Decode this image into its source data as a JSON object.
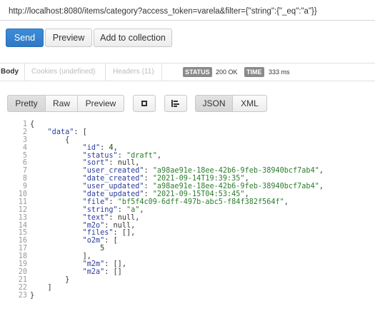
{
  "request": {
    "url": "http://localhost:8080/items/category?access_token=varela&filter={\"string\":{\"_eq\":\"a\"}}"
  },
  "actions": {
    "send_label": "Send",
    "preview_label": "Preview",
    "add_label": "Add to collection"
  },
  "tabs": {
    "body": "Body",
    "cookies": "Cookies (undefined)",
    "headers": "Headers (11)"
  },
  "status": {
    "status_label": "STATUS",
    "status_value": "200 OK",
    "time_label": "TIME",
    "time_value": "333 ms"
  },
  "format": {
    "pretty": "Pretty",
    "raw": "Raw",
    "preview": "Preview",
    "json": "JSON",
    "xml": "XML"
  },
  "response_lines": [
    [
      [
        "p",
        "{"
      ]
    ],
    [
      [
        "p",
        "    "
      ],
      [
        "k",
        "\"data\""
      ],
      [
        "p",
        ": ["
      ]
    ],
    [
      [
        "p",
        "        {"
      ]
    ],
    [
      [
        "p",
        "            "
      ],
      [
        "k",
        "\"id\""
      ],
      [
        "p",
        ": "
      ],
      [
        "n",
        "4"
      ],
      [
        "p",
        ","
      ]
    ],
    [
      [
        "p",
        "            "
      ],
      [
        "k",
        "\"status\""
      ],
      [
        "p",
        ": "
      ],
      [
        "s",
        "\"draft\""
      ],
      [
        "p",
        ","
      ]
    ],
    [
      [
        "p",
        "            "
      ],
      [
        "k",
        "\"sort\""
      ],
      [
        "p",
        ": null,"
      ]
    ],
    [
      [
        "p",
        "            "
      ],
      [
        "k",
        "\"user_created\""
      ],
      [
        "p",
        ": "
      ],
      [
        "s",
        "\"a98ae91e-18ee-42b6-9feb-38940bcf7ab4\""
      ],
      [
        "p",
        ","
      ]
    ],
    [
      [
        "p",
        "            "
      ],
      [
        "k",
        "\"date_created\""
      ],
      [
        "p",
        ": "
      ],
      [
        "s",
        "\"2021-09-14T19:39:35\""
      ],
      [
        "p",
        ","
      ]
    ],
    [
      [
        "p",
        "            "
      ],
      [
        "k",
        "\"user_updated\""
      ],
      [
        "p",
        ": "
      ],
      [
        "s",
        "\"a98ae91e-18ee-42b6-9feb-38940bcf7ab4\""
      ],
      [
        "p",
        ","
      ]
    ],
    [
      [
        "p",
        "            "
      ],
      [
        "k",
        "\"date_updated\""
      ],
      [
        "p",
        ": "
      ],
      [
        "s",
        "\"2021-09-15T04:53:45\""
      ],
      [
        "p",
        ","
      ]
    ],
    [
      [
        "p",
        "            "
      ],
      [
        "k",
        "\"file\""
      ],
      [
        "p",
        ": "
      ],
      [
        "s",
        "\"bf5f4c09-6dff-497b-abc5-f84f382f564f\""
      ],
      [
        "p",
        ","
      ]
    ],
    [
      [
        "p",
        "            "
      ],
      [
        "k",
        "\"string\""
      ],
      [
        "p",
        ": "
      ],
      [
        "s",
        "\"a\""
      ],
      [
        "p",
        ","
      ]
    ],
    [
      [
        "p",
        "            "
      ],
      [
        "k",
        "\"text\""
      ],
      [
        "p",
        ": null,"
      ]
    ],
    [
      [
        "p",
        "            "
      ],
      [
        "k",
        "\"m2o\""
      ],
      [
        "p",
        ": null,"
      ]
    ],
    [
      [
        "p",
        "            "
      ],
      [
        "k",
        "\"files\""
      ],
      [
        "p",
        ": [],"
      ]
    ],
    [
      [
        "p",
        "            "
      ],
      [
        "k",
        "\"o2m\""
      ],
      [
        "p",
        ": ["
      ]
    ],
    [
      [
        "p",
        "                "
      ],
      [
        "n",
        "5"
      ]
    ],
    [
      [
        "p",
        "            ],"
      ]
    ],
    [
      [
        "p",
        "            "
      ],
      [
        "k",
        "\"m2m\""
      ],
      [
        "p",
        ": [],"
      ]
    ],
    [
      [
        "p",
        "            "
      ],
      [
        "k",
        "\"m2a\""
      ],
      [
        "p",
        ": []"
      ]
    ],
    [
      [
        "p",
        "        }"
      ]
    ],
    [
      [
        "p",
        "    ]"
      ]
    ],
    [
      [
        "p",
        "}"
      ]
    ]
  ]
}
